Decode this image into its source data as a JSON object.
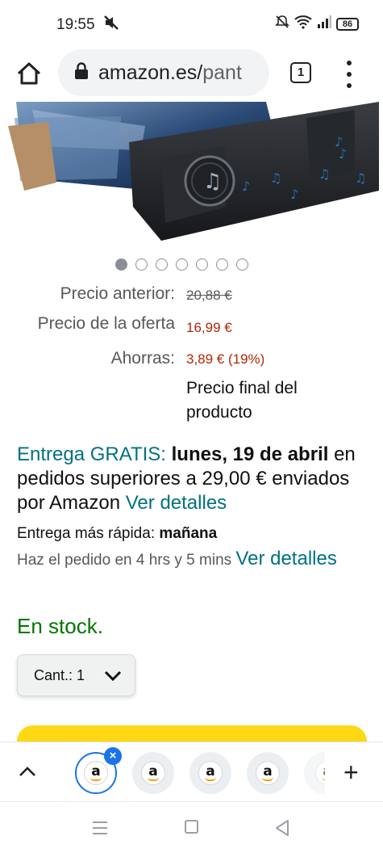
{
  "status_bar": {
    "time": "19:55",
    "battery": "86"
  },
  "browser": {
    "url_main": "amazon.es/",
    "url_rest": "pant",
    "tab_count": "1"
  },
  "carousel": {
    "total": 7,
    "active_index": 0
  },
  "pricing": {
    "previous_label": "Precio anterior:",
    "previous_value": "20,88 €",
    "offer_label": "Precio de la oferta",
    "offer_value": "16,99 €",
    "savings_label": "Ahorras:",
    "savings_value": "3,89 € (19%)",
    "final_note": "Precio final del producto"
  },
  "delivery": {
    "free_label": "Entrega GRATIS:",
    "date": "lunes, 19 de abril",
    "condition": "en pedidos superiores a 29,00 € enviados por Amazon",
    "details_link": "Ver detalles",
    "fast_label": "Entrega más rápida:",
    "fast_value": "mañana",
    "order_text": "Haz el pedido en 4 hrs y 5 mins",
    "order_link": "Ver detalles",
    "stock": "En stock."
  },
  "quantity": {
    "label": "Cant.:",
    "value": "1"
  },
  "tab_strip": {
    "tabs": [
      {
        "letter": "a",
        "active": true
      },
      {
        "letter": "a",
        "active": false
      },
      {
        "letter": "a",
        "active": false
      },
      {
        "letter": "a",
        "active": false
      },
      {
        "letter": "a",
        "active": false
      }
    ],
    "close_symbol": "×",
    "add_symbol": "+"
  },
  "colors": {
    "link": "#007185",
    "price_red": "#b12704",
    "stock_green": "#007600",
    "cart_yellow": "#ffd814",
    "tab_active_blue": "#1a73e8"
  }
}
